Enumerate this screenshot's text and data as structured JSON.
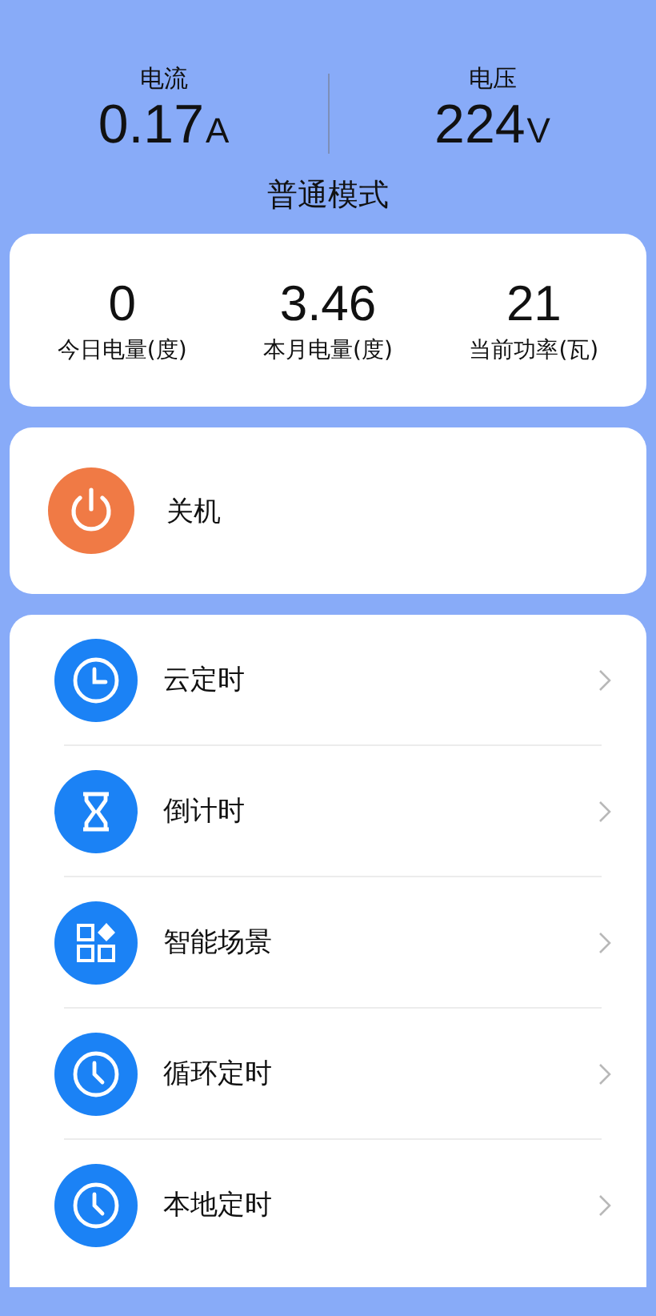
{
  "readings": [
    {
      "label": "电流",
      "value": "0.17",
      "unit": "A"
    },
    {
      "label": "电压",
      "value": "224",
      "unit": "V"
    }
  ],
  "mode": "普通模式",
  "stats": [
    {
      "value": "0",
      "label": "今日电量(度)"
    },
    {
      "value": "3.46",
      "label": "本月电量(度)"
    },
    {
      "value": "21",
      "label": "当前功率(瓦)"
    }
  ],
  "power": {
    "label": "关机"
  },
  "menu": [
    {
      "kind": "clock",
      "label": "云定时"
    },
    {
      "kind": "hourglass",
      "label": "倒计时"
    },
    {
      "kind": "grid",
      "label": "智能场景"
    },
    {
      "kind": "cycle-clock",
      "label": "循环定时"
    },
    {
      "kind": "cycle-clock",
      "label": "本地定时"
    }
  ]
}
